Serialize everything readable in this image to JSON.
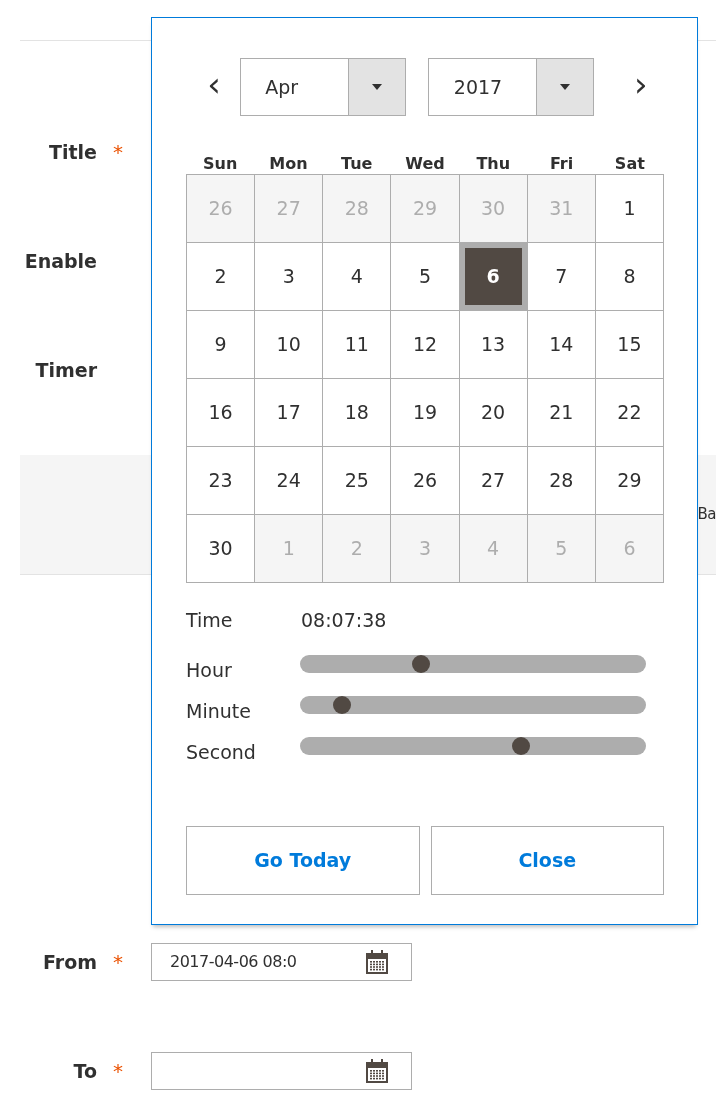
{
  "form": {
    "fields": [
      {
        "label": "Title",
        "required_mark": "*"
      },
      {
        "label": "Enable"
      },
      {
        "label": "Timer"
      }
    ],
    "side_text": "Ba",
    "date_fields": [
      {
        "label": "From",
        "required_mark": "*",
        "value": "2017-04-06 08:0"
      },
      {
        "label": "To",
        "required_mark": "*"
      }
    ]
  },
  "datepicker": {
    "prev": "‹",
    "next": "›",
    "month": "Apr",
    "year": "2017",
    "weekdays": [
      "Sun",
      "Mon",
      "Tue",
      "Wed",
      "Thu",
      "Fri",
      "Sat"
    ],
    "days": [
      {
        "day": "26",
        "other_month": true,
        "selected": false
      },
      {
        "day": "27",
        "other_month": true,
        "selected": false
      },
      {
        "day": "28",
        "other_month": true,
        "selected": false
      },
      {
        "day": "29",
        "other_month": true,
        "selected": false
      },
      {
        "day": "30",
        "other_month": true,
        "selected": false
      },
      {
        "day": "31",
        "other_month": true,
        "selected": false
      },
      {
        "day": "1",
        "other_month": false,
        "selected": false
      },
      {
        "day": "2",
        "other_month": false,
        "selected": false
      },
      {
        "day": "3",
        "other_month": false,
        "selected": false
      },
      {
        "day": "4",
        "other_month": false,
        "selected": false
      },
      {
        "day": "5",
        "other_month": false,
        "selected": false
      },
      {
        "day": "6",
        "other_month": false,
        "selected": true
      },
      {
        "day": "7",
        "other_month": false,
        "selected": false
      },
      {
        "day": "8",
        "other_month": false,
        "selected": false
      },
      {
        "day": "9",
        "other_month": false,
        "selected": false
      },
      {
        "day": "10",
        "other_month": false,
        "selected": false
      },
      {
        "day": "11",
        "other_month": false,
        "selected": false
      },
      {
        "day": "12",
        "other_month": false,
        "selected": false
      },
      {
        "day": "13",
        "other_month": false,
        "selected": false
      },
      {
        "day": "14",
        "other_month": false,
        "selected": false
      },
      {
        "day": "15",
        "other_month": false,
        "selected": false
      },
      {
        "day": "16",
        "other_month": false,
        "selected": false
      },
      {
        "day": "17",
        "other_month": false,
        "selected": false
      },
      {
        "day": "18",
        "other_month": false,
        "selected": false
      },
      {
        "day": "19",
        "other_month": false,
        "selected": false
      },
      {
        "day": "20",
        "other_month": false,
        "selected": false
      },
      {
        "day": "21",
        "other_month": false,
        "selected": false
      },
      {
        "day": "22",
        "other_month": false,
        "selected": false
      },
      {
        "day": "23",
        "other_month": false,
        "selected": false
      },
      {
        "day": "24",
        "other_month": false,
        "selected": false
      },
      {
        "day": "25",
        "other_month": false,
        "selected": false
      },
      {
        "day": "26",
        "other_month": false,
        "selected": false
      },
      {
        "day": "27",
        "other_month": false,
        "selected": false
      },
      {
        "day": "28",
        "other_month": false,
        "selected": false
      },
      {
        "day": "29",
        "other_month": false,
        "selected": false
      },
      {
        "day": "30",
        "other_month": false,
        "selected": false
      },
      {
        "day": "1",
        "other_month": true,
        "selected": false
      },
      {
        "day": "2",
        "other_month": true,
        "selected": false
      },
      {
        "day": "3",
        "other_month": true,
        "selected": false
      },
      {
        "day": "4",
        "other_month": true,
        "selected": false
      },
      {
        "day": "5",
        "other_month": true,
        "selected": false
      },
      {
        "day": "6",
        "other_month": true,
        "selected": false
      }
    ],
    "time_label": "Time",
    "time_value": "08:07:38",
    "sliders": [
      {
        "label": "Hour",
        "level": 0.35
      },
      {
        "label": "Minute",
        "level": 0.12
      },
      {
        "label": "Second",
        "level": 0.64
      }
    ],
    "buttons": [
      "Go Today",
      "Close"
    ]
  }
}
